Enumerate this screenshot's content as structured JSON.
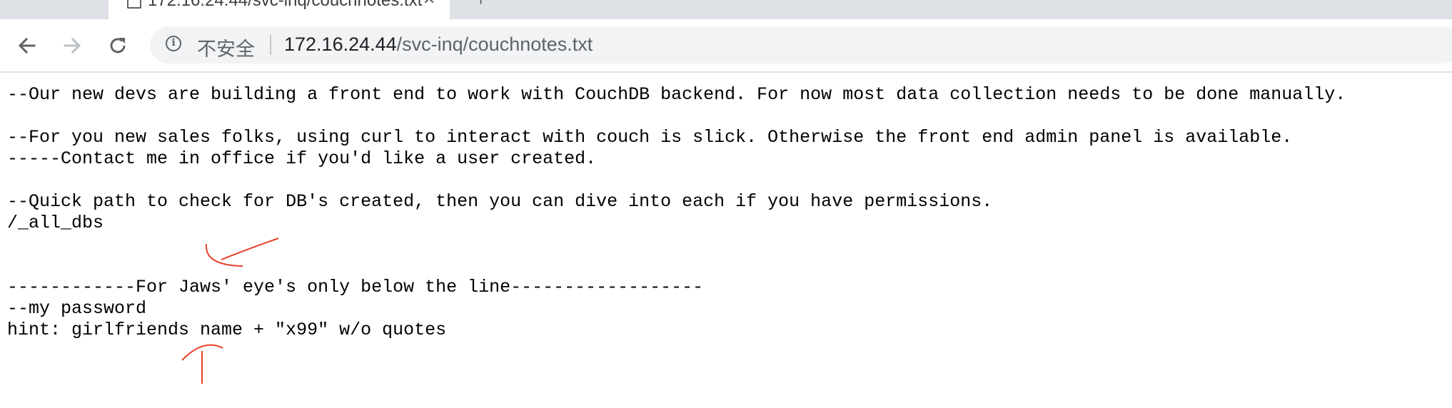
{
  "browser": {
    "tab": {
      "title": "172.16.24.44/svc-inq/couchnotes.txt"
    },
    "toolbar": {
      "back_icon": "arrow-left-icon",
      "forward_icon": "arrow-right-icon",
      "reload_icon": "reload-icon",
      "security_icon": "info-icon",
      "security_label": "不安全",
      "url_host": "172.16.24.44",
      "url_path": "/svc-inq/couchnotes.txt"
    }
  },
  "document": {
    "lines": [
      "--Our new devs are building a front end to work with CouchDB backend. For now most data collection needs to be done manually.",
      "",
      "--For you new sales folks, using curl to interact with couch is slick. Otherwise the front end admin panel is available.",
      "-----Contact me in office if you'd like a user created.",
      "",
      "--Quick path to check for DB's created, then you can dive into each if you have permissions.",
      "/_all_dbs",
      "",
      "",
      "------------For Jaws' eye's only below the line------------------",
      "--my password",
      "hint: girlfriends name + \"x99\" w/o quotes"
    ]
  },
  "annotations": {
    "color": "#e8402a"
  }
}
